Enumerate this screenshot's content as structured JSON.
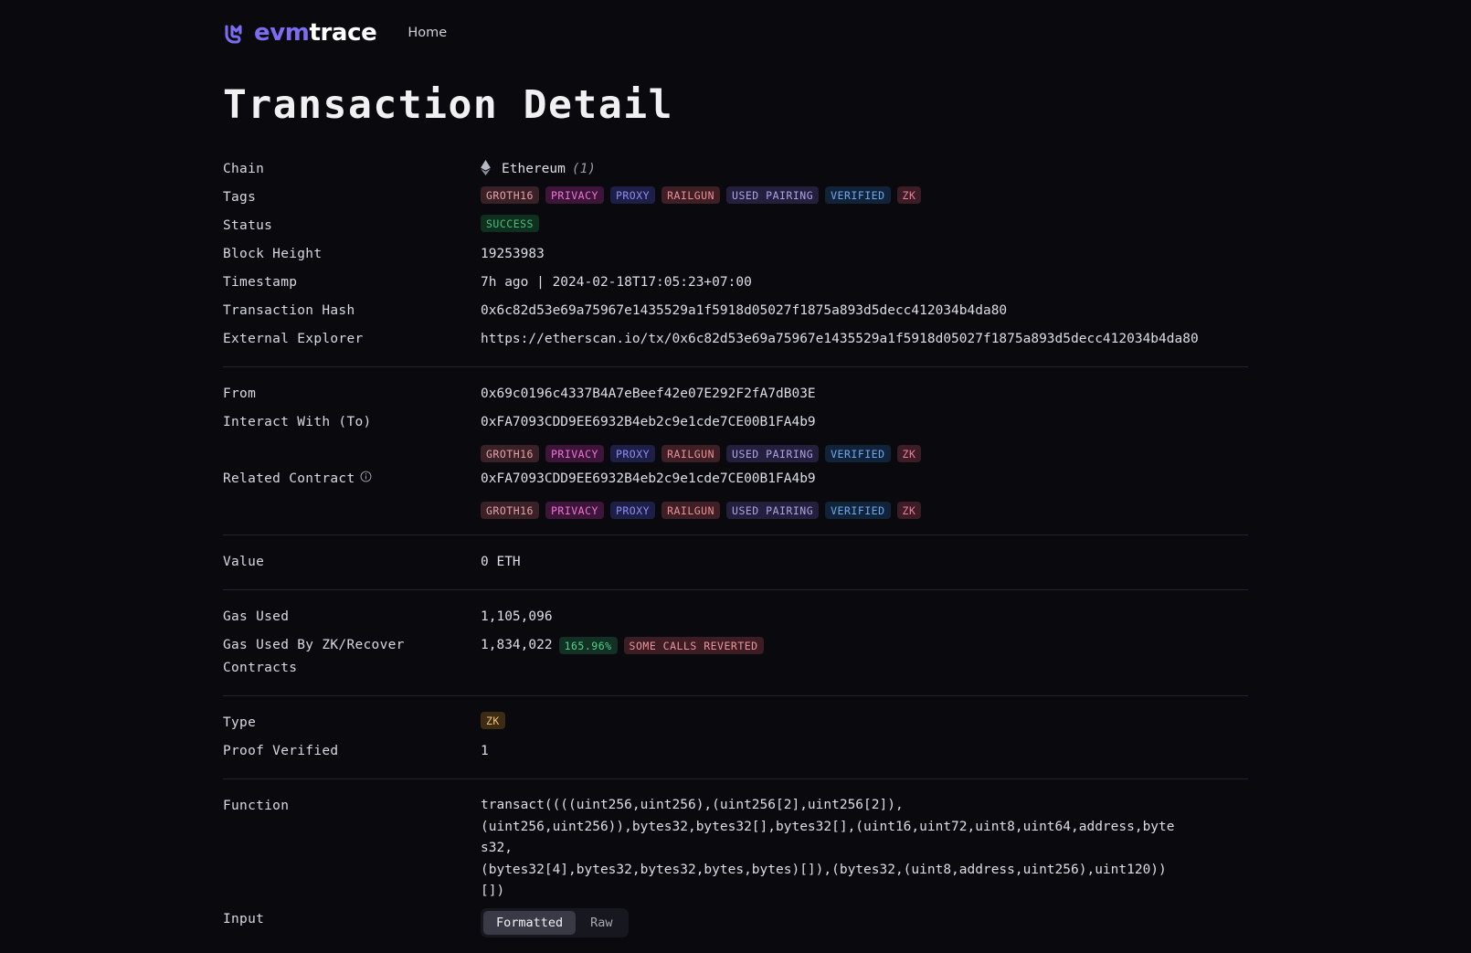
{
  "nav": {
    "brand_primary": "evm",
    "brand_secondary": "trace",
    "brand_icon": "evmtrace-logo-icon",
    "home_label": "Home"
  },
  "page": {
    "title": "Transaction Detail"
  },
  "sections": {
    "overview": {
      "chain": {
        "label": "Chain",
        "icon": "ethereum-icon",
        "name": "Ethereum",
        "id": "(1)"
      },
      "tags": {
        "label": "Tags",
        "values": [
          {
            "text": "GROTH16",
            "style": "groth16"
          },
          {
            "text": "PRIVACY",
            "style": "privacy"
          },
          {
            "text": "PROXY",
            "style": "proxy"
          },
          {
            "text": "RAILGUN",
            "style": "railgun"
          },
          {
            "text": "USED PAIRING",
            "style": "used-pairing"
          },
          {
            "text": "VERIFIED",
            "style": "verified"
          },
          {
            "text": "ZK",
            "style": "zk"
          }
        ]
      },
      "status": {
        "label": "Status",
        "value": "SUCCESS"
      },
      "block_height": {
        "label": "Block Height",
        "value": "19253983"
      },
      "timestamp": {
        "label": "Timestamp",
        "value": "7h ago | 2024-02-18T17:05:23+07:00"
      },
      "transaction_hash": {
        "label": "Transaction Hash",
        "value": "0x6c82d53e69a75967e1435529a1f5918d05027f1875a893d5decc412034b4da80"
      },
      "external_explorer": {
        "label": "External Explorer",
        "value": "https://etherscan.io/tx/0x6c82d53e69a75967e1435529a1f5918d05027f1875a893d5decc412034b4da80"
      }
    },
    "addresses": {
      "from": {
        "label": "From",
        "value": "0x69c0196c4337B4A7eBeef42e07E292F2fA7dB03E"
      },
      "interact_with": {
        "label": "Interact With (To)",
        "value": "0xFA7093CDD9EE6932B4eb2c9e1cde7CE00B1FA4b9",
        "tags": [
          {
            "text": "GROTH16",
            "style": "groth16"
          },
          {
            "text": "PRIVACY",
            "style": "privacy"
          },
          {
            "text": "PROXY",
            "style": "proxy"
          },
          {
            "text": "RAILGUN",
            "style": "railgun"
          },
          {
            "text": "USED PAIRING",
            "style": "used-pairing"
          },
          {
            "text": "VERIFIED",
            "style": "verified"
          },
          {
            "text": "ZK",
            "style": "zk"
          }
        ]
      },
      "related_contract": {
        "label": "Related Contract",
        "icon": "info-circle-icon",
        "value": "0xFA7093CDD9EE6932B4eb2c9e1cde7CE00B1FA4b9",
        "tags": [
          {
            "text": "GROTH16",
            "style": "groth16"
          },
          {
            "text": "PRIVACY",
            "style": "privacy"
          },
          {
            "text": "PROXY",
            "style": "proxy"
          },
          {
            "text": "RAILGUN",
            "style": "railgun"
          },
          {
            "text": "USED PAIRING",
            "style": "used-pairing"
          },
          {
            "text": "VERIFIED",
            "style": "verified"
          },
          {
            "text": "ZK",
            "style": "zk"
          }
        ]
      }
    },
    "value_section": {
      "value": {
        "label": "Value",
        "value": "0 ETH"
      }
    },
    "gas": {
      "gas_used": {
        "label": "Gas Used",
        "value": "1,105,096"
      },
      "gas_used_zk": {
        "label": "Gas Used By ZK/Recover Contracts",
        "value": "1,834,022",
        "percent_badge": "165.96%",
        "reverted_badge": "SOME CALLS REVERTED"
      }
    },
    "proof": {
      "type": {
        "label": "Type",
        "badge": "ZK"
      },
      "proof_verified": {
        "label": "Proof Verified",
        "value": "1"
      }
    },
    "calldata": {
      "function": {
        "label": "Function",
        "value": "transact((((uint256,uint256),(uint256[2],uint256[2]),\n(uint256,uint256)),bytes32,bytes32[],bytes32[],(uint16,uint72,uint8,uint64,address,bytes32,\n(bytes32[4],bytes32,bytes32,bytes,bytes)[]),(bytes32,(uint8,address,uint256),uint120))[])"
      },
      "input": {
        "label": "Input",
        "options": [
          "Formatted",
          "Raw"
        ],
        "selected": "Formatted"
      }
    }
  },
  "colors": {
    "background": "#09090e",
    "brand_purple": "#7c6cf0",
    "divider": "#232330",
    "text_primary": "#e8e8ec",
    "success_green": "#46c07a",
    "amber": "#f4c070"
  }
}
